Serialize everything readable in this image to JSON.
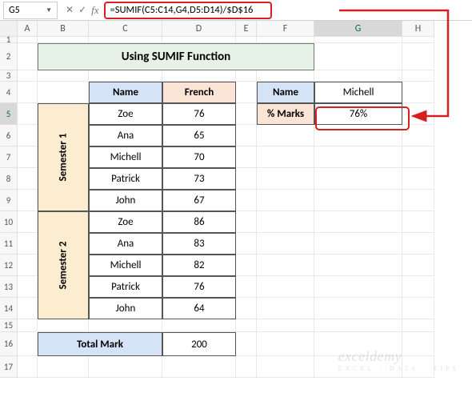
{
  "name_box": "G5",
  "formula": "=SUMIF(C5:C14,G4,D5:D14)/$D$16",
  "columns": [
    "A",
    "B",
    "C",
    "D",
    "E",
    "F",
    "G",
    "H"
  ],
  "rows": [
    "1",
    "2",
    "3",
    "4",
    "5",
    "6",
    "7",
    "8",
    "9",
    "10",
    "11",
    "12",
    "13",
    "14",
    "15",
    "16",
    "17"
  ],
  "title": "Using SUMIF Function",
  "headers": {
    "name": "Name",
    "french": "French"
  },
  "semesters": {
    "s1": "Semester 1",
    "s2": "Semester 2"
  },
  "data": {
    "s1": [
      {
        "name": "Zoe",
        "french": "76"
      },
      {
        "name": "Ana",
        "french": "65"
      },
      {
        "name": "Michell",
        "french": "70"
      },
      {
        "name": "Patrick",
        "french": "73"
      },
      {
        "name": "John",
        "french": "67"
      }
    ],
    "s2": [
      {
        "name": "Zoe",
        "french": "86"
      },
      {
        "name": "Ana",
        "french": "83"
      },
      {
        "name": "Michell",
        "french": "82"
      },
      {
        "name": "Patrick",
        "french": "76"
      },
      {
        "name": "John",
        "french": "64"
      }
    ]
  },
  "total": {
    "label": "Total Mark",
    "value": "200"
  },
  "lookup": {
    "name_label": "Name",
    "name_value": "Michell",
    "marks_label": "% Marks",
    "marks_value": "76%"
  },
  "watermark": {
    "main": "exceldemy",
    "sub": "EXCEL · DATA · TIPS"
  }
}
